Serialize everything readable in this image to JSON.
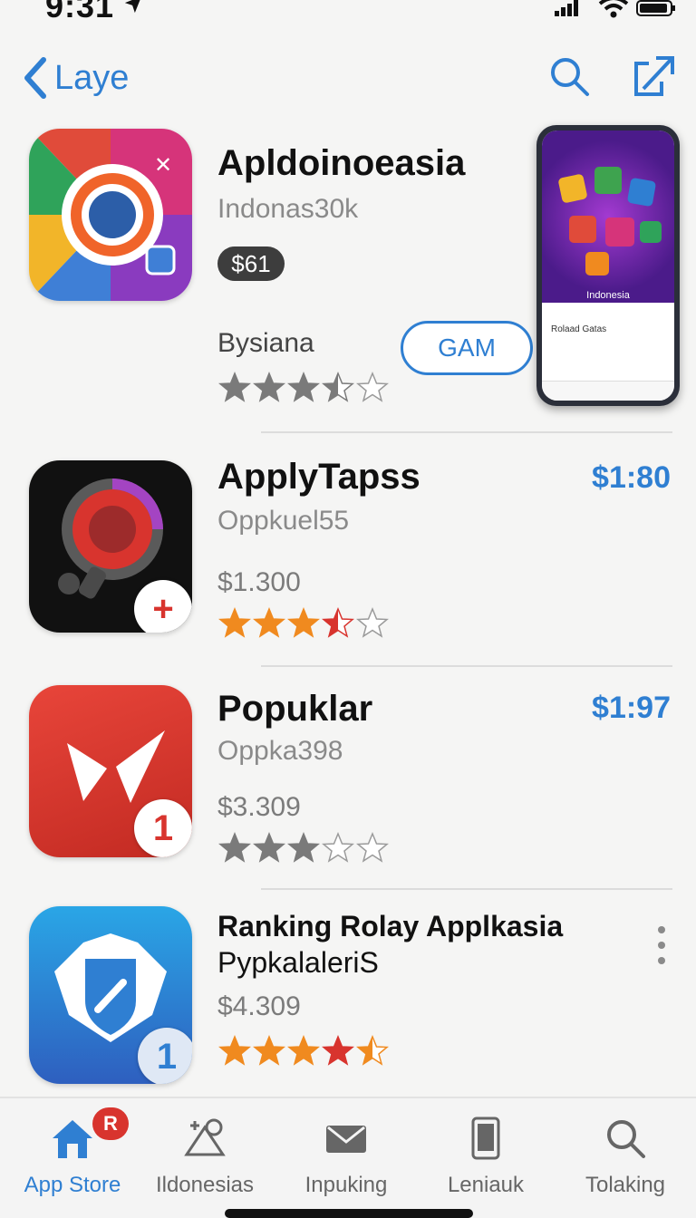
{
  "status_bar": {
    "time": "9:31"
  },
  "nav": {
    "back_label": "Laye"
  },
  "featured": {
    "name": "Apldoinoeasia",
    "subtitle": "Indonas30k",
    "price_badge": "$61",
    "developer": "Bysiana",
    "get_label": "GAM",
    "rating": 3.5,
    "preview": {
      "hero_text": "Indonesia",
      "list_title": "Rolaad Gatas"
    }
  },
  "apps": [
    {
      "name": "ApplyTapss",
      "subtitle": "Oppkuel55",
      "price": "$1.300",
      "corner_price": "$1:80",
      "rating": 3.5,
      "badge": "+"
    },
    {
      "name": "Popuklar",
      "subtitle": "Oppka398",
      "price": "$3.309",
      "corner_price": "$1:97",
      "rating": 3,
      "badge": "1"
    },
    {
      "name_line1": "Ranking Rolay Applkasia",
      "name_line2": "PypkalaleriS",
      "price": "$4.309",
      "rating": 4.5,
      "badge": "1"
    }
  ],
  "tab_bar": {
    "badge_count": "R",
    "tabs": [
      {
        "label": "App Store",
        "icon": "home-icon",
        "active": true
      },
      {
        "label": "Ildonesias",
        "icon": "games-icon"
      },
      {
        "label": "Inpuking",
        "icon": "mail-icon"
      },
      {
        "label": "Leniauk",
        "icon": "tablet-icon"
      },
      {
        "label": "Tolaking",
        "icon": "search-icon"
      }
    ]
  },
  "colors": {
    "accent": "#2f7fd2",
    "star_gray": "#7a7a7a",
    "star_orange": "#f08a1f",
    "star_red": "#d8342e"
  }
}
